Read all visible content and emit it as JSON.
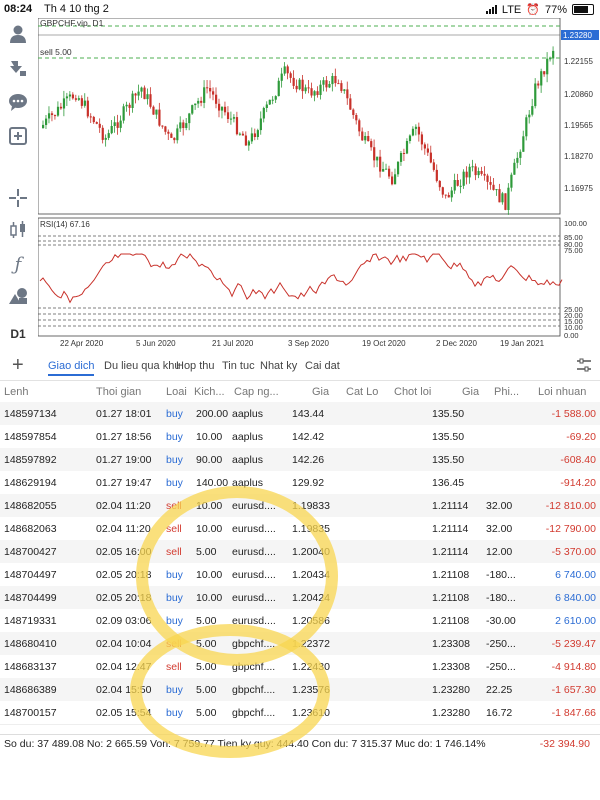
{
  "status_bar": {
    "time": "08:24",
    "date": "Th 4 10 thg 2",
    "network": "LTE",
    "battery": "77%"
  },
  "toolbar": {
    "icons": [
      "person-icon",
      "download-icon",
      "chat-icon",
      "add-square-icon",
      "crosshair-icon",
      "candles-icon",
      "function-icon",
      "objects-icon"
    ],
    "timeframe": "D1"
  },
  "chart": {
    "symbol_label": "GBPCHF.vip, D1",
    "order_labels": [
      "sell 5.00",
      "sell 5.00"
    ],
    "current_price": "1.23280",
    "price_ticks": [
      "1.22155",
      "1.20860",
      "1.19565",
      "1.18270",
      "1.16975"
    ],
    "rsi_label": "RSI(14) 67.16",
    "rsi_ticks": [
      "100.00",
      "85.00",
      "80.00",
      "75.00",
      "25.00",
      "20.00",
      "15.00",
      "10.00",
      "0.00"
    ],
    "date_ticks": [
      "22 Apr 2020",
      "5 Jun 2020",
      "21 Jul 2020",
      "3 Sep 2020",
      "19 Oct 2020",
      "2 Dec 2020",
      "19 Jan 2021"
    ],
    "colors": {
      "bull": "#2e9a3a",
      "bear": "#c8312a",
      "rsi": "#c8312a",
      "order_line": "#4caf50",
      "price_tag": "#2b6cd4"
    }
  },
  "tabs": [
    "Giao dich",
    "Du lieu qua khu",
    "Hop thu",
    "Tin tuc",
    "Nhat ky",
    "Cai dat"
  ],
  "columns": [
    "Lenh",
    "Thoi gian",
    "Loai",
    "Kich...",
    "Cap ng...",
    "Gia",
    "Cat Lo",
    "Chot loi",
    "Gia",
    "Phi...",
    "Loi nhuan"
  ],
  "rows": [
    {
      "id": "148597134",
      "time": "01.27 18:01",
      "type": "buy",
      "size": "200.00",
      "symbol": "aaplus",
      "open": "143.44",
      "sl": "",
      "tp": "",
      "price": "135.50",
      "fee": "",
      "profit": "-1 588.00"
    },
    {
      "id": "148597854",
      "time": "01.27 18:56",
      "type": "buy",
      "size": "10.00",
      "symbol": "aaplus",
      "open": "142.42",
      "sl": "",
      "tp": "",
      "price": "135.50",
      "fee": "",
      "profit": "-69.20"
    },
    {
      "id": "148597892",
      "time": "01.27 19:00",
      "type": "buy",
      "size": "90.00",
      "symbol": "aaplus",
      "open": "142.26",
      "sl": "",
      "tp": "",
      "price": "135.50",
      "fee": "",
      "profit": "-608.40"
    },
    {
      "id": "148629194",
      "time": "01.27 19:47",
      "type": "buy",
      "size": "140.00",
      "symbol": "aaplus",
      "open": "129.92",
      "sl": "",
      "tp": "",
      "price": "136.45",
      "fee": "",
      "profit": "-914.20"
    },
    {
      "id": "148682055",
      "time": "02.04 11:20",
      "type": "sell",
      "size": "10.00",
      "symbol": "eurusd....",
      "open": "1.19833",
      "sl": "",
      "tp": "",
      "price": "1.21114",
      "fee": "32.00",
      "profit": "-12 810.00"
    },
    {
      "id": "148682063",
      "time": "02.04 11:20",
      "type": "sell",
      "size": "10.00",
      "symbol": "eurusd....",
      "open": "1.19835",
      "sl": "",
      "tp": "",
      "price": "1.21114",
      "fee": "32.00",
      "profit": "-12 790.00"
    },
    {
      "id": "148700427",
      "time": "02.05 16:00",
      "type": "sell",
      "size": "5.00",
      "symbol": "eurusd....",
      "open": "1.20040",
      "sl": "",
      "tp": "",
      "price": "1.21114",
      "fee": "12.00",
      "profit": "-5 370.00"
    },
    {
      "id": "148704497",
      "time": "02.05 20:18",
      "type": "buy",
      "size": "10.00",
      "symbol": "eurusd....",
      "open": "1.20434",
      "sl": "",
      "tp": "",
      "price": "1.21108",
      "fee": "-180...",
      "profit": "6 740.00"
    },
    {
      "id": "148704499",
      "time": "02.05 20:18",
      "type": "buy",
      "size": "10.00",
      "symbol": "eurusd....",
      "open": "1.20424",
      "sl": "",
      "tp": "",
      "price": "1.21108",
      "fee": "-180...",
      "profit": "6 840.00"
    },
    {
      "id": "148719331",
      "time": "02.09 03:06",
      "type": "buy",
      "size": "5.00",
      "symbol": "eurusd....",
      "open": "1.20586",
      "sl": "",
      "tp": "",
      "price": "1.21108",
      "fee": "-30.00",
      "profit": "2 610.00"
    },
    {
      "id": "148680410",
      "time": "02.04 10:04",
      "type": "sell",
      "size": "5.00",
      "symbol": "gbpchf....",
      "open": "1.22372",
      "sl": "",
      "tp": "",
      "price": "1.23308",
      "fee": "-250...",
      "profit": "-5 239.47"
    },
    {
      "id": "148683137",
      "time": "02.04 12:47",
      "type": "sell",
      "size": "5.00",
      "symbol": "gbpchf....",
      "open": "1.22430",
      "sl": "",
      "tp": "",
      "price": "1.23308",
      "fee": "-250...",
      "profit": "-4 914.80"
    },
    {
      "id": "148686389",
      "time": "02.04 15:50",
      "type": "buy",
      "size": "5.00",
      "symbol": "gbpchf....",
      "open": "1.23576",
      "sl": "",
      "tp": "",
      "price": "1.23280",
      "fee": "22.25",
      "profit": "-1 657.30"
    },
    {
      "id": "148700157",
      "time": "02.05 15:54",
      "type": "buy",
      "size": "5.00",
      "symbol": "gbpchf....",
      "open": "1.23610",
      "sl": "",
      "tp": "",
      "price": "1.23280",
      "fee": "16.72",
      "profit": "-1 847.66"
    }
  ],
  "summary": {
    "text": "So du: 37 489.08 No: 2 665.59 Von: 7 759.77 Tien ky quy: 444.40 Con du: 7 315.37 Muc do: 1 746.14%",
    "total": "-32 394.90"
  }
}
